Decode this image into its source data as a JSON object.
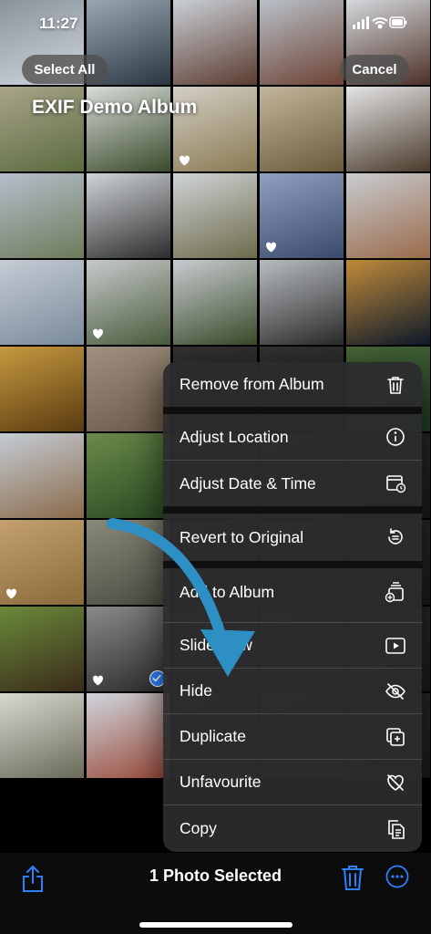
{
  "status_bar": {
    "time": "11:27"
  },
  "header": {
    "select_all_label": "Select All",
    "cancel_label": "Cancel",
    "album_title": "EXIF Demo Album"
  },
  "context_menu": {
    "items": [
      {
        "label": "Remove from Album",
        "icon": "trash-icon"
      },
      {
        "label": "Adjust Location",
        "icon": "location-info-icon"
      },
      {
        "label": "Adjust Date & Time",
        "icon": "calendar-clock-icon"
      },
      {
        "label": "Revert to Original",
        "icon": "revert-icon"
      },
      {
        "label": "Add to Album",
        "icon": "add-to-album-icon"
      },
      {
        "label": "Slideshow",
        "icon": "play-icon"
      },
      {
        "label": "Hide",
        "icon": "eye-slash-icon"
      },
      {
        "label": "Duplicate",
        "icon": "duplicate-icon"
      },
      {
        "label": "Unfavourite",
        "icon": "heart-slash-icon"
      },
      {
        "label": "Copy",
        "icon": "copy-icon"
      }
    ]
  },
  "toolbar": {
    "selected_label": "1 Photo Selected"
  },
  "colors": {
    "accent": "#2f80ff",
    "annotation_arrow": "#2e8fc4",
    "menu_bg": "#2c2c2e"
  },
  "photos": [
    {
      "subject": "snowy slope",
      "c1": "#cfd6dd",
      "c2": "#8a939c",
      "fav": false
    },
    {
      "subject": "snowy pine forest",
      "c1": "#2a3642",
      "c2": "#9aa7b3",
      "fav": false
    },
    {
      "subject": "hotel in snow",
      "c1": "#5b3b2f",
      "c2": "#c9cfd6",
      "fav": false
    },
    {
      "subject": "hotel in snow",
      "c1": "#6d4234",
      "c2": "#b8c0c8",
      "fav": false
    },
    {
      "subject": "hotel in snow",
      "c1": "#4d3026",
      "c2": "#d4d8dc",
      "fav": false
    },
    {
      "subject": "bird on branch",
      "c1": "#5a6b3e",
      "c2": "#a9a48a",
      "fav": false
    },
    {
      "subject": "bird on tree",
      "c1": "#3b4a2c",
      "c2": "#d8dcd8",
      "fav": false
    },
    {
      "subject": "bird on twig",
      "c1": "#8a7a52",
      "c2": "#d3cfc5",
      "fav": true
    },
    {
      "subject": "sparrow",
      "c1": "#6a5a3a",
      "c2": "#c2b69a",
      "fav": false
    },
    {
      "subject": "bird on stem",
      "c1": "#4a3a2a",
      "c2": "#e4e4e6",
      "fav": false
    },
    {
      "subject": "garden pavilion",
      "c1": "#6e7a5a",
      "c2": "#b5bfcc",
      "fav": false
    },
    {
      "subject": "bare tree from below",
      "c1": "#2c2c2c",
      "c2": "#d0d4d8",
      "fav": false
    },
    {
      "subject": "willow trees",
      "c1": "#6d6a4a",
      "c2": "#cfd3d6",
      "fav": false
    },
    {
      "subject": "lake and mountains",
      "c1": "#3a4a6a",
      "c2": "#8fa0c0",
      "fav": true
    },
    {
      "subject": "stone gateway",
      "c1": "#9a6a4a",
      "c2": "#c8ccd0",
      "fav": false
    },
    {
      "subject": "houseboats",
      "c1": "#7a8a9a",
      "c2": "#c4ccd4",
      "fav": false
    },
    {
      "subject": "garden path",
      "c1": "#4a5a3a",
      "c2": "#c6cacc",
      "fav": true
    },
    {
      "subject": "parakeet",
      "c1": "#3a4a2a",
      "c2": "#c8ccd0",
      "fav": false
    },
    {
      "subject": "birds on tree",
      "c1": "#2a2a2a",
      "c2": "#b8bcc0",
      "fav": false
    },
    {
      "subject": "city lights",
      "c1": "#0d1a2a",
      "c2": "#c08a3a",
      "fav": false
    },
    {
      "subject": "buddha statues",
      "c1": "#5a3a10",
      "c2": "#c69a40",
      "fav": false
    },
    {
      "subject": "ruins corridor",
      "c1": "#6a5a48",
      "c2": "#a09080",
      "fav": false
    },
    {
      "subject": "",
      "c1": "#222",
      "c2": "#333",
      "fav": false
    },
    {
      "subject": "",
      "c1": "#222",
      "c2": "#333",
      "fav": false
    },
    {
      "subject": "forest",
      "c1": "#1e3a22",
      "c2": "#4a6a3a",
      "fav": false
    },
    {
      "subject": "india gate",
      "c1": "#8a6a4a",
      "c2": "#c4ccd4",
      "fav": false
    },
    {
      "subject": "peacock",
      "c1": "#2a4a22",
      "c2": "#6a8a4a",
      "fav": false
    },
    {
      "subject": "",
      "c1": "#222",
      "c2": "#333",
      "fav": false
    },
    {
      "subject": "",
      "c1": "#222",
      "c2": "#333",
      "fav": false
    },
    {
      "subject": "",
      "c1": "#1a1a1a",
      "c2": "#2a2a2a",
      "fav": false
    },
    {
      "subject": "deer",
      "c1": "#8a6a3a",
      "c2": "#c4a070",
      "fav": true
    },
    {
      "subject": "rocks",
      "c1": "#4a4a40",
      "c2": "#8a8a7a",
      "fav": false
    },
    {
      "subject": "",
      "c1": "#222",
      "c2": "#333",
      "fav": false
    },
    {
      "subject": "",
      "c1": "#222",
      "c2": "#333",
      "fav": false
    },
    {
      "subject": "",
      "c1": "#1a1a1a",
      "c2": "#2a2a2a",
      "fav": false
    },
    {
      "subject": "tree trunk",
      "c1": "#3a2a1a",
      "c2": "#6a8a3a",
      "fav": false
    },
    {
      "subject": "elephant",
      "c1": "#2a2a2a",
      "c2": "#8a8a8a",
      "fav": true,
      "selected": true
    },
    {
      "subject": "",
      "c1": "#222",
      "c2": "#333",
      "fav": false
    },
    {
      "subject": "",
      "c1": "#222",
      "c2": "#333",
      "fav": false
    },
    {
      "subject": "",
      "c1": "#1a1a1a",
      "c2": "#2a2a2a",
      "fav": false
    },
    {
      "subject": "white tiger",
      "c1": "#6a6a5a",
      "c2": "#d8d8d0",
      "fav": false
    },
    {
      "subject": "humayun tomb",
      "c1": "#9a4a3a",
      "c2": "#cfd6dd",
      "fav": false
    },
    {
      "subject": "",
      "c1": "#222",
      "c2": "#333",
      "fav": false
    },
    {
      "subject": "",
      "c1": "#222",
      "c2": "#333",
      "fav": false
    },
    {
      "subject": "",
      "c1": "#1a1a1a",
      "c2": "#2a2a2a",
      "fav": false
    }
  ]
}
